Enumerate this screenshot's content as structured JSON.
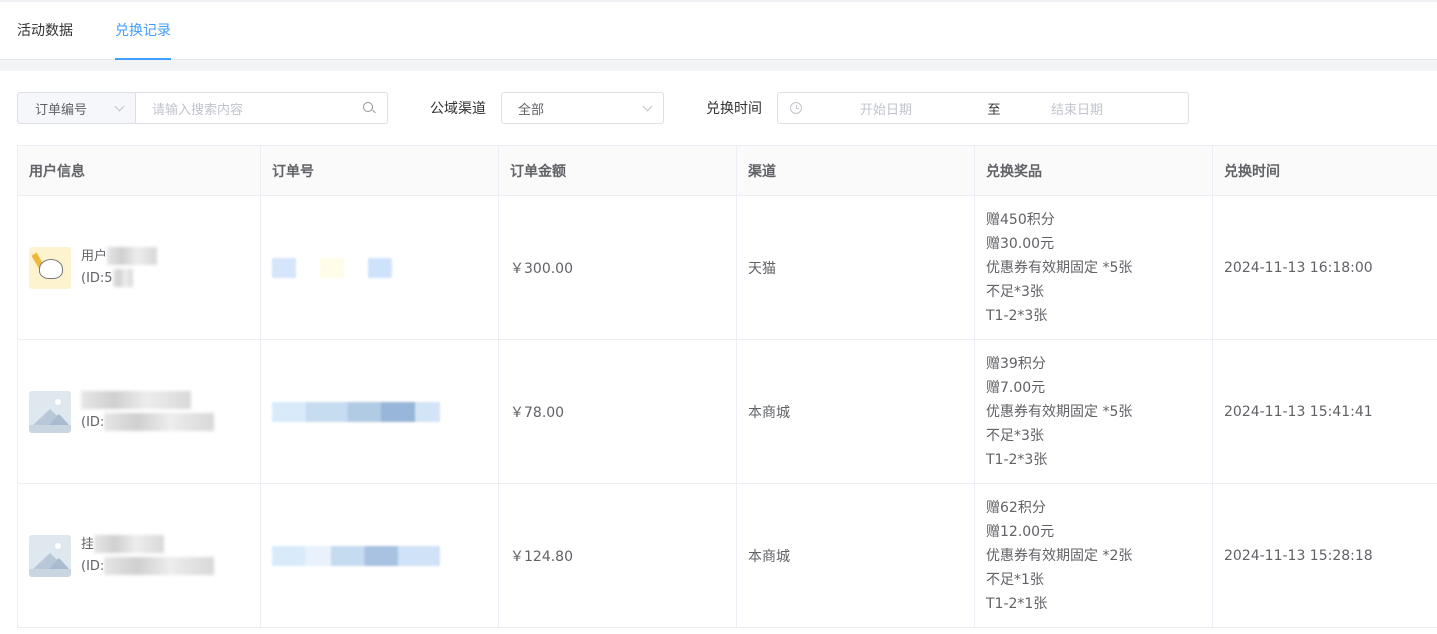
{
  "tabs": [
    {
      "label": "活动数据",
      "active": false
    },
    {
      "label": "兑换记录",
      "active": true
    }
  ],
  "filters": {
    "search_type": "订单编号",
    "search_placeholder": "请输入搜索内容",
    "channel_label": "公域渠道",
    "channel_value": "全部",
    "time_label": "兑换时间",
    "start_placeholder": "开始日期",
    "range_separator": "至",
    "end_placeholder": "结束日期"
  },
  "table": {
    "columns": [
      "用户信息",
      "订单号",
      "订单金额",
      "渠道",
      "兑换奖品",
      "兑换时间"
    ],
    "rows": [
      {
        "user_name": "用户",
        "user_id": "(ID:5",
        "amount": "￥300.00",
        "channel": "天猫",
        "prizes": [
          "赠450积分",
          "赠30.00元",
          "优惠券有效期固定 *5张",
          "不足*3张",
          "T1-2*3张"
        ],
        "time": "2024-11-13 16:18:00",
        "avatar": "cat"
      },
      {
        "user_name": "",
        "user_id": "(ID:",
        "amount": "￥78.00",
        "channel": "本商城",
        "prizes": [
          "赠39积分",
          "赠7.00元",
          "优惠券有效期固定 *5张",
          "不足*3张",
          "T1-2*3张"
        ],
        "time": "2024-11-13 15:41:41",
        "avatar": "placeholder"
      },
      {
        "user_name": "挂",
        "user_id": "(ID:",
        "amount": "￥124.80",
        "channel": "本商城",
        "prizes": [
          "赠62积分",
          "赠12.00元",
          "优惠券有效期固定 *2张",
          "不足*1张",
          "T1-2*1张"
        ],
        "time": "2024-11-13 15:28:18",
        "avatar": "placeholder"
      }
    ]
  },
  "colors": {
    "accent": "#409eff",
    "border": "#ebeef5",
    "text": "#606266"
  }
}
